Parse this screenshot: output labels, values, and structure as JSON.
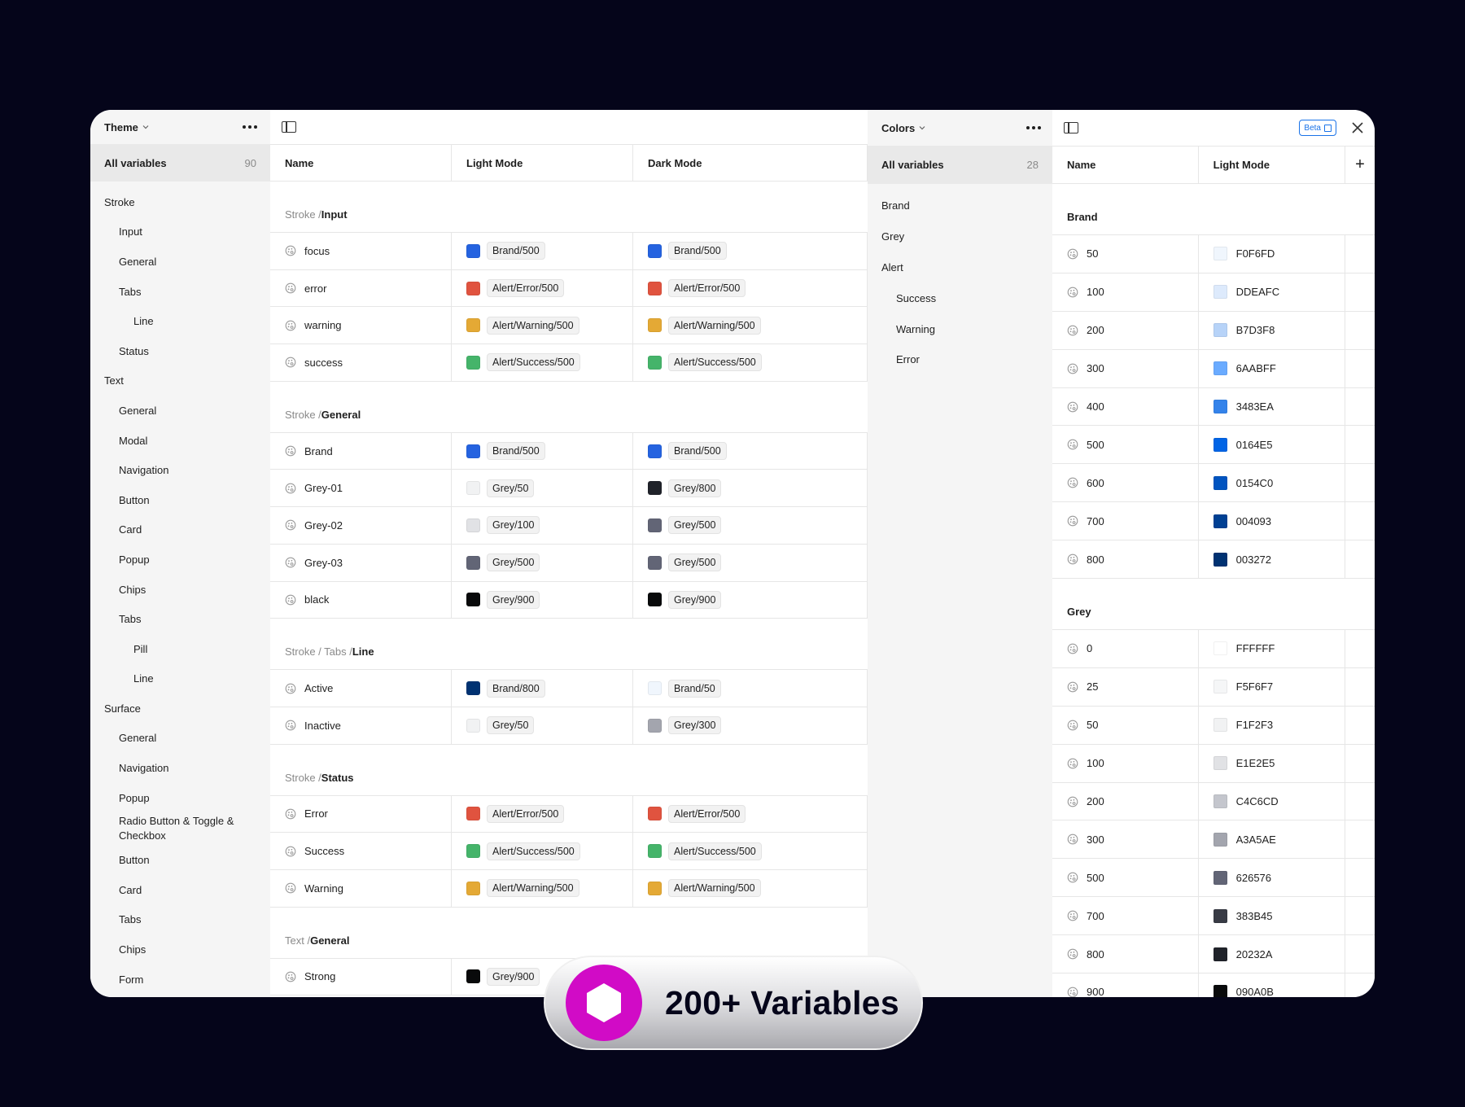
{
  "left_collection": {
    "title": "Theme",
    "all_variables_label": "All variables",
    "all_variables_count": "90",
    "tree": [
      {
        "label": "Stroke",
        "level": 0
      },
      {
        "label": "Input",
        "level": 1
      },
      {
        "label": "General",
        "level": 1
      },
      {
        "label": "Tabs",
        "level": 1
      },
      {
        "label": "Line",
        "level": 2
      },
      {
        "label": "Status",
        "level": 1
      },
      {
        "label": "Text",
        "level": 0
      },
      {
        "label": "General",
        "level": 1
      },
      {
        "label": "Modal",
        "level": 1
      },
      {
        "label": "Navigation",
        "level": 1
      },
      {
        "label": "Button",
        "level": 1
      },
      {
        "label": "Card",
        "level": 1
      },
      {
        "label": "Popup",
        "level": 1
      },
      {
        "label": "Chips",
        "level": 1
      },
      {
        "label": "Tabs",
        "level": 1
      },
      {
        "label": "Pill",
        "level": 2
      },
      {
        "label": "Line",
        "level": 2
      },
      {
        "label": "Surface",
        "level": 0
      },
      {
        "label": "General",
        "level": 1
      },
      {
        "label": "Navigation",
        "level": 1
      },
      {
        "label": "Popup",
        "level": 1
      },
      {
        "label": "Radio Button & Toggle & Checkbox",
        "level": 1,
        "multiline": true
      },
      {
        "label": "Button",
        "level": 1
      },
      {
        "label": "Card",
        "level": 1
      },
      {
        "label": "Tabs",
        "level": 1
      },
      {
        "label": "Chips",
        "level": 1
      },
      {
        "label": "Form",
        "level": 1
      }
    ]
  },
  "theme_table": {
    "columns": [
      "Name",
      "Light Mode",
      "Dark Mode"
    ],
    "groups": [
      {
        "path": "Stroke / ",
        "leaf": "Input",
        "rows": [
          {
            "name": "focus",
            "light": "Brand/500",
            "light_color": "#2563e0",
            "dark": "Brand/500",
            "dark_color": "#2563e0"
          },
          {
            "name": "error",
            "light": "Alert/Error/500",
            "light_color": "#e0533f",
            "dark": "Alert/Error/500",
            "dark_color": "#e0533f"
          },
          {
            "name": "warning",
            "light": "Alert/Warning/500",
            "light_color": "#e4a935",
            "dark": "Alert/Warning/500",
            "dark_color": "#e4a935"
          },
          {
            "name": "success",
            "light": "Alert/Success/500",
            "light_color": "#45b46a",
            "dark": "Alert/Success/500",
            "dark_color": "#45b46a"
          }
        ]
      },
      {
        "path": "Stroke / ",
        "leaf": "General",
        "rows": [
          {
            "name": "Brand",
            "light": "Brand/500",
            "light_color": "#2563e0",
            "dark": "Brand/500",
            "dark_color": "#2563e0"
          },
          {
            "name": "Grey-01",
            "light": "Grey/50",
            "light_color": "#f1f2f3",
            "dark": "Grey/800",
            "dark_color": "#20232a"
          },
          {
            "name": "Grey-02",
            "light": "Grey/100",
            "light_color": "#e1e2e5",
            "dark": "Grey/500",
            "dark_color": "#626576"
          },
          {
            "name": "Grey-03",
            "light": "Grey/500",
            "light_color": "#626576",
            "dark": "Grey/500",
            "dark_color": "#626576"
          },
          {
            "name": "black",
            "light": "Grey/900",
            "light_color": "#090a0b",
            "dark": "Grey/900",
            "dark_color": "#090a0b"
          }
        ]
      },
      {
        "path": "Stroke / Tabs / ",
        "leaf": "Line",
        "rows": [
          {
            "name": "Active",
            "light": "Brand/800",
            "light_color": "#003272",
            "dark": "Brand/50",
            "dark_color": "#f0f6fd"
          },
          {
            "name": "Inactive",
            "light": "Grey/50",
            "light_color": "#f1f2f3",
            "dark": "Grey/300",
            "dark_color": "#a3a5ae"
          }
        ]
      },
      {
        "path": "Stroke / ",
        "leaf": "Status",
        "rows": [
          {
            "name": "Error",
            "light": "Alert/Error/500",
            "light_color": "#e0533f",
            "dark": "Alert/Error/500",
            "dark_color": "#e0533f"
          },
          {
            "name": "Success",
            "light": "Alert/Success/500",
            "light_color": "#45b46a",
            "dark": "Alert/Success/500",
            "dark_color": "#45b46a"
          },
          {
            "name": "Warning",
            "light": "Alert/Warning/500",
            "light_color": "#e4a935",
            "dark": "Alert/Warning/500",
            "dark_color": "#e4a935"
          }
        ]
      },
      {
        "path": "Text / ",
        "leaf": "General",
        "rows": [
          {
            "name": "Strong",
            "light": "Grey/900",
            "light_color": "#090a0b",
            "dark": "",
            "dark_color": ""
          }
        ]
      }
    ]
  },
  "right_collection": {
    "title": "Colors",
    "all_variables_label": "All variables",
    "all_variables_count": "28",
    "tree": [
      {
        "label": "Brand",
        "level": 0
      },
      {
        "label": "Grey",
        "level": 0
      },
      {
        "label": "Alert",
        "level": 0
      },
      {
        "label": "Success",
        "level": 1
      },
      {
        "label": "Warning",
        "level": 1
      },
      {
        "label": "Error",
        "level": 1
      }
    ],
    "beta_label": "Beta"
  },
  "colors_table": {
    "columns": [
      "Name",
      "Light Mode"
    ],
    "add_label": "+",
    "groups": [
      {
        "title": "Brand",
        "rows": [
          {
            "name": "50",
            "value": "F0F6FD",
            "color": "#f0f6fd"
          },
          {
            "name": "100",
            "value": "DDEAFC",
            "color": "#ddeafc"
          },
          {
            "name": "200",
            "value": "B7D3F8",
            "color": "#b7d3f8"
          },
          {
            "name": "300",
            "value": "6AABFF",
            "color": "#6aabff"
          },
          {
            "name": "400",
            "value": "3483EA",
            "color": "#3483ea"
          },
          {
            "name": "500",
            "value": "0164E5",
            "color": "#0164e5"
          },
          {
            "name": "600",
            "value": "0154C0",
            "color": "#0154c0"
          },
          {
            "name": "700",
            "value": "004093",
            "color": "#004093"
          },
          {
            "name": "800",
            "value": "003272",
            "color": "#003272"
          }
        ]
      },
      {
        "title": "Grey",
        "rows": [
          {
            "name": "0",
            "value": "FFFFFF",
            "color": "#ffffff"
          },
          {
            "name": "25",
            "value": "F5F6F7",
            "color": "#f5f6f7"
          },
          {
            "name": "50",
            "value": "F1F2F3",
            "color": "#f1f2f3"
          },
          {
            "name": "100",
            "value": "E1E2E5",
            "color": "#e1e2e5"
          },
          {
            "name": "200",
            "value": "C4C6CD",
            "color": "#c4c6cd"
          },
          {
            "name": "300",
            "value": "A3A5AE",
            "color": "#a3a5ae"
          },
          {
            "name": "500",
            "value": "626576",
            "color": "#626576"
          },
          {
            "name": "700",
            "value": "383B45",
            "color": "#383b45"
          },
          {
            "name": "800",
            "value": "20232A",
            "color": "#20232a"
          },
          {
            "name": "900",
            "value": "090A0B",
            "color": "#090a0b"
          }
        ]
      }
    ]
  },
  "badge": {
    "text": "200+ Variables",
    "icon": "hexagon-icon",
    "accent": "#d10bc6"
  }
}
